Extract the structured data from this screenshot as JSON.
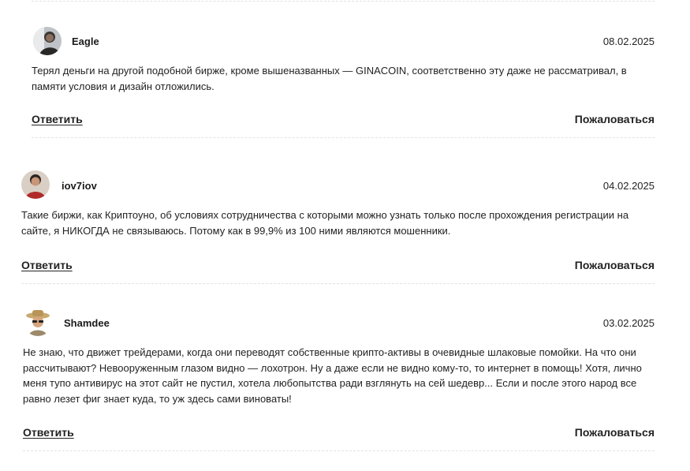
{
  "comments": [
    {
      "author": "Eagle",
      "date": "08.02.2025",
      "text": "Терял деньги на другой подобной бирже, кроме вышеназванных — GINACOIN, соответственно эту даже не рассматривал, в памяти условия и дизайн отложились.",
      "reply_label": "Ответить",
      "report_label": "Пожаловаться",
      "avatar_icon": "user-avatar-eagle"
    },
    {
      "author": "iov7iov",
      "date": "04.02.2025",
      "text": "Такие биржи, как Криптоуно, об условиях сотрудничества с которыми можно узнать только после прохождения регистрации на сайте, я НИКОГДА не связываюсь. Потому как в 99,9% из 100 ними являются мошенники.",
      "reply_label": "Ответить",
      "report_label": "Пожаловаться",
      "avatar_icon": "user-avatar-iov7iov"
    },
    {
      "author": "Shamdee",
      "date": "03.02.2025",
      "text": "Не знаю, что движет трейдерами, когда они переводят собственные крипто-активы в очевидные шлаковые помойки. На что они рассчитывают? Невооруженным глазом видно — лохотрон. Ну а даже если не видно кому-то, то интернет в помощь! Хотя, лично меня тупо антивирус на этот сайт не пустил, хотела любопытства ради взглянуть на сей шедевр... Если и после этого народ все равно лезет фиг знает куда, то уж здесь сами виноваты!",
      "reply_label": "Ответить",
      "report_label": "Пожаловаться",
      "avatar_icon": "user-avatar-shamdee"
    }
  ],
  "colors": {
    "text": "#222222",
    "divider": "#e2e2e2",
    "background": "#ffffff"
  }
}
